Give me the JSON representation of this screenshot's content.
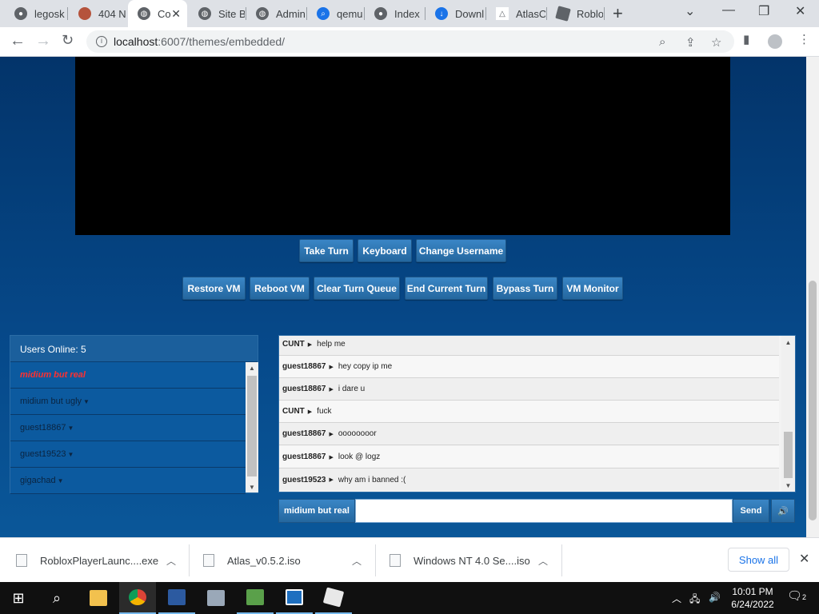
{
  "browser": {
    "tabs": [
      {
        "label": "legosk",
        "icon": "github-icon"
      },
      {
        "label": "404 N",
        "icon": "avatar-icon"
      },
      {
        "label": "Co",
        "icon": "globe-icon",
        "active": true
      },
      {
        "label": "Site Bl",
        "icon": "globe-icon"
      },
      {
        "label": "Admin",
        "icon": "globe-icon"
      },
      {
        "label": "qemu-",
        "icon": "search-icon"
      },
      {
        "label": "Index",
        "icon": "github-icon"
      },
      {
        "label": "Downl",
        "icon": "download-icon"
      },
      {
        "label": "AtlasO",
        "icon": "triangle-icon"
      },
      {
        "label": "Roblo",
        "icon": "roblox-icon"
      }
    ],
    "new_tab": "+",
    "url_host": "localhost",
    "url_rest": ":6007/themes/embedded/"
  },
  "vm": {
    "buttons_row1": [
      "Take Turn",
      "Keyboard",
      "Change Username"
    ],
    "buttons_row2": [
      "Restore VM",
      "Reboot VM",
      "Clear Turn Queue",
      "End Current Turn",
      "Bypass Turn",
      "VM Monitor"
    ]
  },
  "users": {
    "header": "Users Online: 5",
    "list": [
      {
        "name": "midium but real",
        "self": true
      },
      {
        "name": "midium but ugly"
      },
      {
        "name": "guest18867"
      },
      {
        "name": "guest19523"
      },
      {
        "name": "gigachad"
      }
    ]
  },
  "chat": {
    "messages": [
      {
        "user": "CUNT",
        "text": "help me"
      },
      {
        "user": "guest18867",
        "text": "hey copy ip me"
      },
      {
        "user": "guest18867",
        "text": "i dare u"
      },
      {
        "user": "CUNT",
        "text": "fuck"
      },
      {
        "user": "guest18867",
        "text": "oooooooor"
      },
      {
        "user": "guest18867",
        "text": "look @ logz"
      },
      {
        "user": "guest19523",
        "text": "why am i banned :("
      }
    ],
    "username": "midium but real",
    "input_value": "",
    "send_label": "Send"
  },
  "downloads": {
    "items": [
      "RobloxPlayerLaunc....exe",
      "Atlas_v0.5.2.iso",
      "Windows NT 4.0 Se....iso"
    ],
    "show_all": "Show all"
  },
  "taskbar": {
    "time": "10:01 PM",
    "date": "6/24/2022",
    "notifications": "2"
  }
}
